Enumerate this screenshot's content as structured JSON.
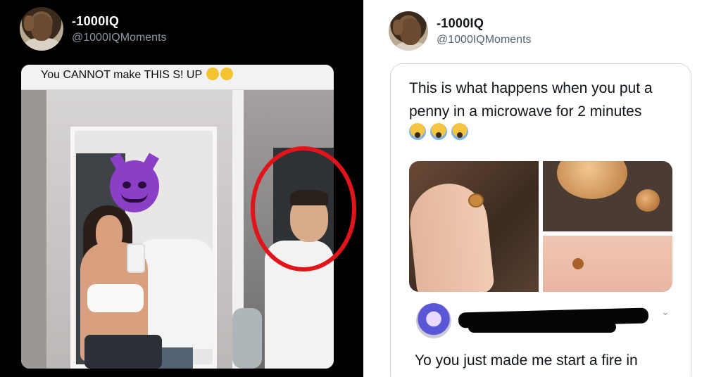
{
  "left_tweet": {
    "display_name": "-1000IQ",
    "handle": "@1000IQMoments",
    "caption": "You CANNOT make THIS S!    UP"
  },
  "right_tweet": {
    "display_name": "-1000IQ",
    "handle": "@1000IQMoments",
    "text": "This is what happens when you put a penny in a microwave for 2 minutes",
    "emoji_count": 3,
    "reply_text": "Yo you just made me start a fire in"
  },
  "colors": {
    "highlight_circle": "#e2141b",
    "left_background": "#000000",
    "right_background": "#ffffff"
  }
}
